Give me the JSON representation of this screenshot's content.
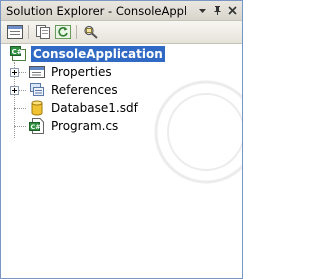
{
  "window": {
    "title": "Solution Explorer - ConsoleAppli..."
  },
  "tree": {
    "root": {
      "label": "ConsoleApplication",
      "icon": "csharp-project-icon"
    },
    "items": [
      {
        "label": "Properties",
        "icon": "properties-icon",
        "expandable": true
      },
      {
        "label": "References",
        "icon": "references-icon",
        "expandable": true
      },
      {
        "label": "Database1.sdf",
        "icon": "database-icon",
        "expandable": false
      },
      {
        "label": "Program.cs",
        "icon": "csharp-file-icon",
        "expandable": false
      }
    ]
  },
  "colors": {
    "selection": "#316ac5",
    "titlebar": "#dcd9d0",
    "border": "#7a96c4"
  }
}
